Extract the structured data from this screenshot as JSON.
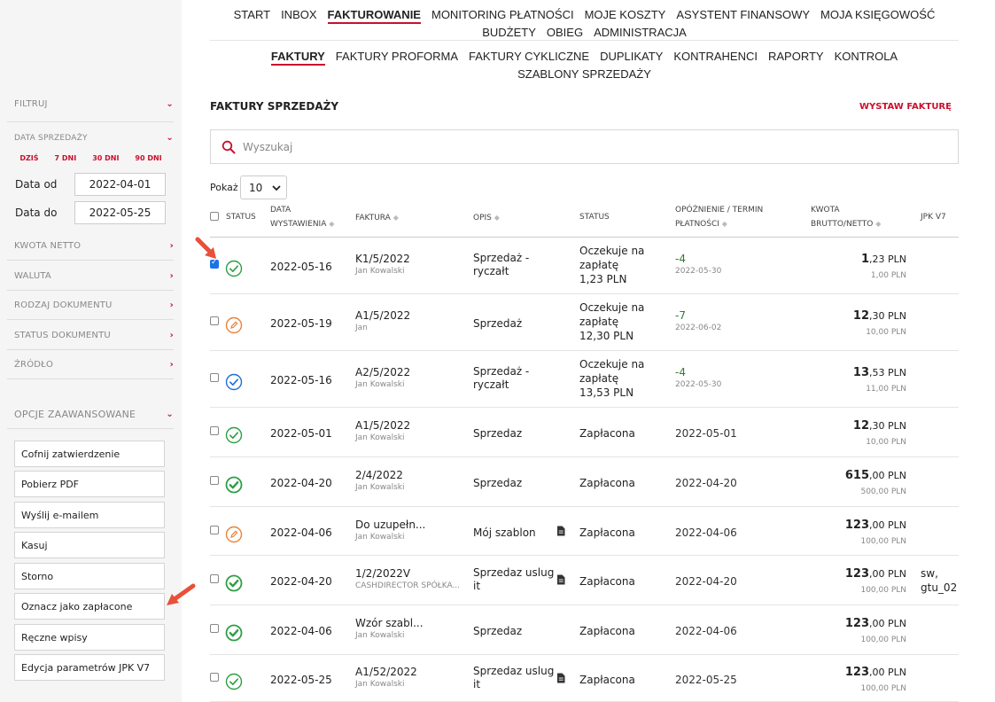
{
  "nav": {
    "main": [
      "START",
      "INBOX",
      "FAKTUROWANIE",
      "MONITORING PŁATNOŚCI",
      "MOJE KOSZTY",
      "ASYSTENT FINANSOWY",
      "MOJA KSIĘGOWOŚĆ",
      "BUDŻETY",
      "OBIEG",
      "ADMINISTRACJA"
    ],
    "sub": [
      "FAKTURY",
      "FAKTURY PROFORMA",
      "FAKTURY CYKLICZNE",
      "DUPLIKATY",
      "KONTRAHENCI",
      "RAPORTY",
      "KONTROLA",
      "SZABLONY SPRZEDAŻY"
    ]
  },
  "sidebar": {
    "filter_label": "FILTRUJ",
    "sale_date_label": "DATA SPRZEDAŻY",
    "quick": [
      "DZIŚ",
      "7 DNI",
      "30 DNI",
      "90 DNI"
    ],
    "date_from_label": "Data od",
    "date_from": "2022-04-01",
    "date_to_label": "Data do",
    "date_to": "2022-05-25",
    "filters": [
      "KWOTA NETTO",
      "WALUTA",
      "RODZAJ DOKUMENTU",
      "STATUS DOKUMENTU",
      "ŹRÓDŁO"
    ],
    "advanced_label": "OPCJE ZAAWANSOWANE",
    "actions": [
      "Cofnij zatwierdzenie",
      "Pobierz PDF",
      "Wyślij e-mailem",
      "Kasuj",
      "Storno",
      "Oznacz jako zapłacone",
      "Ręczne wpisy",
      "Edycja parametrów JPK V7"
    ]
  },
  "page": {
    "title": "FAKTURY SPRZEDAŻY",
    "issue_button": "WYSTAW FAKTURĘ",
    "search_placeholder": "Wyszukaj",
    "show_label": "Pokaż",
    "show_value": "10"
  },
  "table": {
    "headers": {
      "status": "STATUS",
      "date_1": "DATA",
      "date_2": "WYSTAWIENIA",
      "invoice": "FAKTURA",
      "desc": "OPIS",
      "status2": "STATUS",
      "delay_1": "OPÓŹNIENIE / TERMIN",
      "delay_2": "PŁATNOŚCI",
      "amount_1": "KWOTA",
      "amount_2": "BRUTTO/NETTO",
      "jpk": "JPK V7"
    },
    "rows": [
      {
        "date": "2022-05-16",
        "inv": "K1/5/2022",
        "who": "Jan Kowalski",
        "d1": "Sprzedaż -",
        "d2": "ryczałt",
        "s1": "Oczekuje na",
        "s2": "zapłatę",
        "s3": "1,23 PLN",
        "delay": "-4",
        "due": "2022-05-30",
        "gi": "1",
        "gd": ",23 PLN",
        "net": "1,00 PLN",
        "jpk1": "",
        "jpk2": ""
      },
      {
        "date": "2022-05-19",
        "inv": "A1/5/2022",
        "who": "Jan",
        "d1": "Sprzedaż",
        "d2": "",
        "s1": "Oczekuje na",
        "s2": "zapłatę",
        "s3": "12,30 PLN",
        "delay": "-7",
        "due": "2022-06-02",
        "gi": "12",
        "gd": ",30 PLN",
        "net": "10,00 PLN",
        "jpk1": "",
        "jpk2": ""
      },
      {
        "date": "2022-05-16",
        "inv": "A2/5/2022",
        "who": "Jan Kowalski",
        "d1": "Sprzedaż -",
        "d2": "ryczałt",
        "s1": "Oczekuje na",
        "s2": "zapłatę",
        "s3": "13,53 PLN",
        "delay": "-4",
        "due": "2022-05-30",
        "gi": "13",
        "gd": ",53 PLN",
        "net": "11,00 PLN",
        "jpk1": "",
        "jpk2": ""
      },
      {
        "date": "2022-05-01",
        "inv": "A1/5/2022",
        "who": "Jan Kowalski",
        "d1": "Sprzedaz",
        "d2": "",
        "s1": "Zapłacona",
        "s2": "",
        "s3": "",
        "delay": "2022-05-01",
        "due": "",
        "gi": "12",
        "gd": ",30 PLN",
        "net": "10,00 PLN",
        "jpk1": "",
        "jpk2": ""
      },
      {
        "date": "2022-04-20",
        "inv": "2/4/2022",
        "who": "Jan Kowalski",
        "d1": "Sprzedaz",
        "d2": "",
        "s1": "Zapłacona",
        "s2": "",
        "s3": "",
        "delay": "2022-04-20",
        "due": "",
        "gi": "615",
        "gd": ",00 PLN",
        "net": "500,00 PLN",
        "jpk1": "",
        "jpk2": ""
      },
      {
        "date": "2022-04-06",
        "inv": "Do uzupełn...",
        "who": "Jan Kowalski",
        "d1": "Mój szablon",
        "d2": "",
        "s1": "Zapłacona",
        "s2": "",
        "s3": "",
        "delay": "2022-04-06",
        "due": "",
        "gi": "123",
        "gd": ",00 PLN",
        "net": "100,00 PLN",
        "jpk1": "",
        "jpk2": ""
      },
      {
        "date": "2022-04-20",
        "inv": "1/2/2022V",
        "who": "CASHDIRECTOR SPÓŁKA...",
        "d1": "Sprzedaz uslug",
        "d2": "it",
        "s1": "Zapłacona",
        "s2": "",
        "s3": "",
        "delay": "2022-04-20",
        "due": "",
        "gi": "123",
        "gd": ",00 PLN",
        "net": "100,00 PLN",
        "jpk1": "sw,",
        "jpk2": "gtu_02"
      },
      {
        "date": "2022-04-06",
        "inv": "Wzór szabl...",
        "who": "Jan Kowalski",
        "d1": "Sprzedaz",
        "d2": "",
        "s1": "Zapłacona",
        "s2": "",
        "s3": "",
        "delay": "2022-04-06",
        "due": "",
        "gi": "123",
        "gd": ",00 PLN",
        "net": "100,00 PLN",
        "jpk1": "",
        "jpk2": ""
      },
      {
        "date": "2022-05-25",
        "inv": "A1/52/2022",
        "who": "Jan Kowalski",
        "d1": "Sprzedaz uslug",
        "d2": "it",
        "s1": "Zapłacona",
        "s2": "",
        "s3": "",
        "delay": "2022-05-25",
        "due": "",
        "gi": "123",
        "gd": ",00 PLN",
        "net": "100,00 PLN",
        "jpk1": "",
        "jpk2": ""
      }
    ]
  },
  "colors": {
    "accent": "#c8102e",
    "green": "#2e9e44",
    "orange": "#e8833a",
    "blue": "#1e6fd9",
    "arrow": "#e8503a"
  }
}
